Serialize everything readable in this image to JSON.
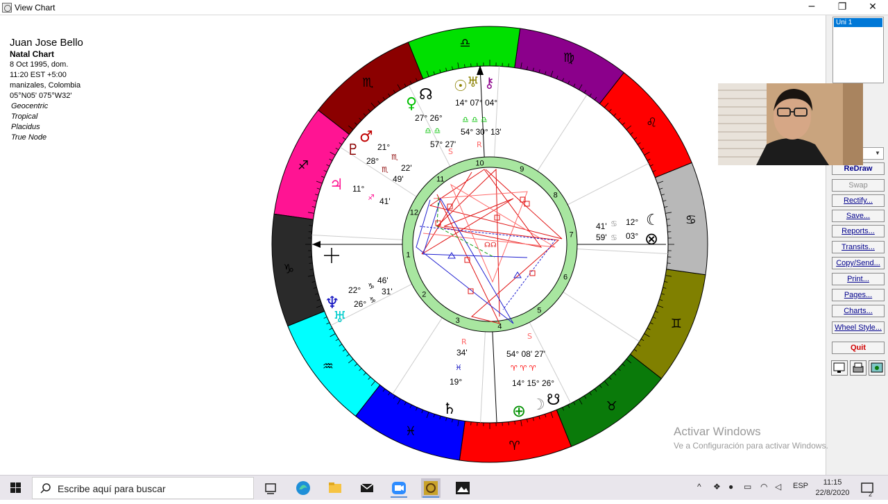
{
  "window": {
    "title": "View Chart",
    "controls": [
      "─",
      "❐",
      "✕"
    ]
  },
  "chart_info": {
    "name": "Juan Jose Bello",
    "chart_type": "Natal Chart",
    "date": "8 Oct 1995, dom.",
    "time": "11:20  EST +5:00",
    "place": "manizales, Colombia",
    "coords": "05°N05' 075°W32'",
    "settings": [
      "Geocentric",
      "Tropical",
      "Placidus",
      "True Node"
    ]
  },
  "colors": {
    "aries": "#ff0000",
    "taurus": "#0a7a0a",
    "gemini": "#808000",
    "cancer": "#b8b8b8",
    "leo": "#ff0000",
    "virgo": "#8b008b",
    "libra": "#00e000",
    "scorpio": "#8b0000",
    "sagittarius": "#ff1493",
    "capricorn": "#2a2a2a",
    "aquarius": "#00ffff",
    "pisces": "#0000ff",
    "house_ring": "#a8e6a0",
    "quit": "#d00000"
  },
  "zodiac": [
    {
      "sign": "Aries",
      "glyph": "♈"
    },
    {
      "sign": "Taurus",
      "glyph": "♉"
    },
    {
      "sign": "Gemini",
      "glyph": "♊"
    },
    {
      "sign": "Cancer",
      "glyph": "♋"
    },
    {
      "sign": "Leo",
      "glyph": "♌"
    },
    {
      "sign": "Virgo",
      "glyph": "♍"
    },
    {
      "sign": "Libra",
      "glyph": "♎"
    },
    {
      "sign": "Scorpio",
      "glyph": "♏"
    },
    {
      "sign": "Sagittarius",
      "glyph": "♐"
    },
    {
      "sign": "Capricorn",
      "glyph": "♑"
    },
    {
      "sign": "Aquarius",
      "glyph": "♒"
    },
    {
      "sign": "Pisces",
      "glyph": "♓"
    }
  ],
  "houses": [
    "10",
    "9",
    "8",
    "7",
    "6",
    "5",
    "4",
    "3",
    "2",
    "1",
    "12",
    "11"
  ],
  "planets": {
    "sun_group": {
      "glyphs": "☉ ♅ ⚷",
      "degrees": "14° 07° 04°",
      "signs": "♎ ♎ ♎"
    },
    "mercury": {
      "degrees": "54° 30° 13'",
      "minutes": "57° 27'",
      "retro": "R"
    },
    "venus_node": {
      "glyphs": "♀ ☊",
      "degrees": "27° 26°",
      "signs": "♎ ♎"
    },
    "mars_pluto": {
      "glyphs": "♂ ♇",
      "degrees": "21° 28°",
      "signs": "♏ ♏",
      "minutes": "22' 49'"
    },
    "jupiter": {
      "glyph": "♃",
      "degree": "11°",
      "sign": "♐",
      "minutes": "41'"
    },
    "moon": {
      "glyph": "☾",
      "degree": "12°",
      "minutes": "41'",
      "sign": "♋"
    },
    "pof": {
      "glyph": "⊗",
      "degree": "03°",
      "minutes": "59'",
      "sign": "♋"
    },
    "neptune_uranus": {
      "glyphs": "♆ ♅",
      "degrees": "22° 26°",
      "signs": "♑ ♑",
      "minutes": "46' 31'"
    },
    "saturn": {
      "glyph": "♄",
      "degree": "19°",
      "sign": "♓",
      "minutes": "34'",
      "retro": "R"
    },
    "earth_group": {
      "glyphs": "⊕ ☽ ☋",
      "degrees": "14° 15° 26°",
      "signs": "♈ ♈ ♈",
      "minutes": "54° 08' 27'",
      "retro": "S"
    }
  },
  "sidebar": {
    "list_item": "Uni 1",
    "buttons": [
      {
        "label": "ReDraw",
        "state": "bold"
      },
      {
        "label": "Swap",
        "state": "disabled"
      },
      {
        "label": "Rectify...",
        "state": "normal"
      },
      {
        "label": "Save...",
        "state": "normal"
      },
      {
        "label": "Reports...",
        "state": "normal"
      },
      {
        "label": "Transits...",
        "state": "normal"
      },
      {
        "label": "Copy/Send...",
        "state": "normal"
      },
      {
        "label": "Print...",
        "state": "normal"
      },
      {
        "label": "Pages...",
        "state": "normal"
      },
      {
        "label": "Charts...",
        "state": "normal"
      },
      {
        "label": "Wheel Style...",
        "state": "normal"
      },
      {
        "label": "Quit",
        "state": "quit"
      }
    ]
  },
  "watermark": {
    "title": "Activar Windows",
    "subtitle": "Ve a Configuración para activar Windows."
  },
  "taskbar": {
    "search_placeholder": "Escribe aquí para buscar",
    "lang": "ESP",
    "time": "11:15",
    "date": "22/8/2020",
    "notifications": "2"
  }
}
